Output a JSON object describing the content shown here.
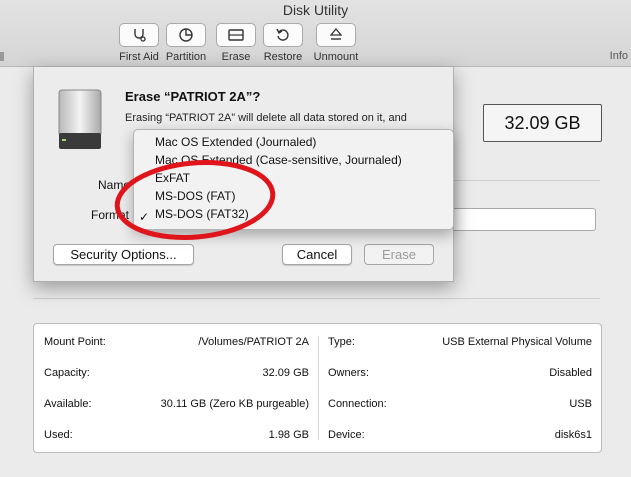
{
  "window": {
    "title": "Disk Utility"
  },
  "toolbar": {
    "buttons": [
      {
        "label": "First Aid",
        "icon": "stethoscope-icon"
      },
      {
        "label": "Partition",
        "icon": "pie-chart-icon"
      },
      {
        "label": "Erase",
        "icon": "eraser-icon"
      },
      {
        "label": "Restore",
        "icon": "restore-icon"
      },
      {
        "label": "Unmount",
        "icon": "eject-icon"
      }
    ],
    "info_label": "Info"
  },
  "capacity": "32.09 GB",
  "erase_dialog": {
    "title": "Erase “PATRIOT 2A”?",
    "message": "Erasing “PATRIOT 2A” will delete all data stored on it, and",
    "name_label": "Name",
    "format_label": "Format",
    "security_button": "Security Options...",
    "cancel_button": "Cancel",
    "erase_button": "Erase"
  },
  "format_menu": {
    "items": [
      "Mac OS Extended (Journaled)",
      "Mac OS Extended (Case-sensitive, Journaled)",
      "ExFAT",
      "MS-DOS (FAT)",
      "MS-DOS (FAT32)"
    ],
    "selected": "MS-DOS (FAT32)",
    "check": "✓"
  },
  "annotation_color": "#e0151b",
  "info": {
    "left": [
      {
        "key": "Mount Point:",
        "value": "/Volumes/PATRIOT 2A"
      },
      {
        "key": "Capacity:",
        "value": "32.09 GB"
      },
      {
        "key": "Available:",
        "value": "30.11 GB (Zero KB purgeable)"
      },
      {
        "key": "Used:",
        "value": "1.98 GB"
      }
    ],
    "right": [
      {
        "key": "Type:",
        "value": "USB External Physical Volume"
      },
      {
        "key": "Owners:",
        "value": "Disabled"
      },
      {
        "key": "Connection:",
        "value": "USB"
      },
      {
        "key": "Device:",
        "value": "disk6s1"
      }
    ]
  }
}
